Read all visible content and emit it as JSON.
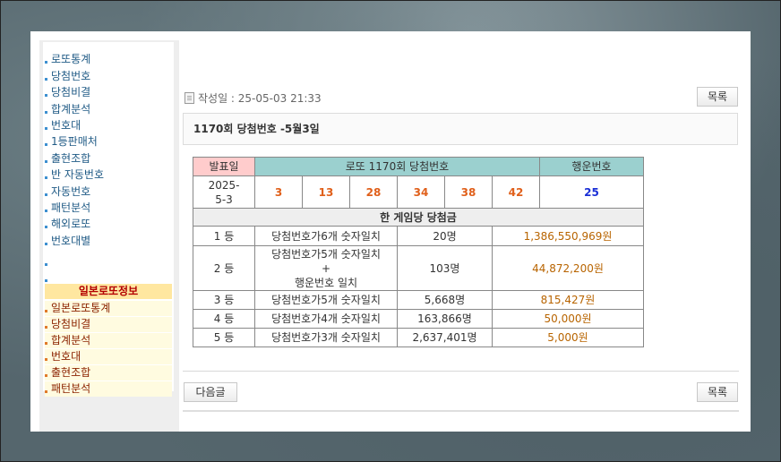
{
  "sidebar": {
    "items": [
      "로또통계",
      "당첨번호",
      "당첨비결",
      "합계분석",
      "번호대",
      "1등판매처",
      "출현조합",
      "반 자동번호",
      "자동번호",
      "패턴분석",
      "해외로또",
      "번호대별"
    ],
    "japan_header": "일본로또정보",
    "japan_items": [
      "일본로또통계",
      "당첨비결",
      "합계분석",
      "번호대",
      "출현조합",
      "패턴분석"
    ]
  },
  "post": {
    "date_label": "작성일 : 25-05-03 21:33",
    "list_button": "목록",
    "title": "1170회 당첨번호 -5월3일",
    "next_button": "다음글"
  },
  "lotto": {
    "header_date": "발표일",
    "header_numbers": "로또 1170회 당첨번호",
    "header_bonus": "행운번호",
    "date_line1": "2025-",
    "date_line2": "5-3",
    "numbers": [
      "3",
      "13",
      "28",
      "34",
      "38",
      "42"
    ],
    "bonus": "25",
    "prize_title": "한 게임당 당첨금",
    "prizes": [
      {
        "rank": "1 등",
        "condition": "당첨번호가6개 숫자일치",
        "winners": "20명",
        "amount": "1,386,550,969원"
      },
      {
        "rank": "2 등",
        "condition_line1": "당첨번호가5개 숫자일치",
        "condition_line2": "+",
        "condition_line3": "행운번호 일치",
        "winners": "103명",
        "amount": "44,872,200원"
      },
      {
        "rank": "3 등",
        "condition": "당첨번호가5개 숫자일치",
        "winners": "5,668명",
        "amount": "815,427원"
      },
      {
        "rank": "4 등",
        "condition": "당첨번호가4개 숫자일치",
        "winners": "163,866명",
        "amount": "50,000원"
      },
      {
        "rank": "5 등",
        "condition": "당첨번호가3개 숫자일치",
        "winners": "2,637,401명",
        "amount": "5,000원"
      }
    ]
  }
}
